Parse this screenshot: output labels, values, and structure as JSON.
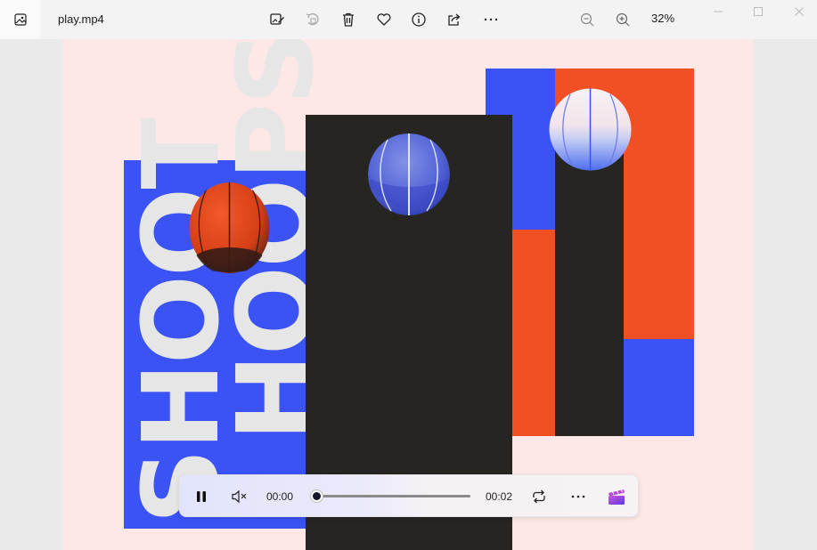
{
  "window": {
    "title": "play.mp4",
    "zoom": "32%"
  },
  "toolbar": {
    "icons": [
      "edit-image-icon",
      "rotate-icon",
      "delete-icon",
      "favorite-heart-icon",
      "info-icon",
      "share-icon",
      "more-icon",
      "zoom-out-icon",
      "zoom-in-icon"
    ]
  },
  "artwork": {
    "line1": "SHOOT",
    "line2": "HOOPS",
    "colors": {
      "blue": "#3b52f5",
      "orange": "#f05023",
      "dark": "#272522",
      "text": "#e6e6e6",
      "background": "#fde7e7"
    }
  },
  "player": {
    "state": "playing",
    "muted": true,
    "current_time": "00:00",
    "duration": "00:02",
    "progress": 0.04
  }
}
